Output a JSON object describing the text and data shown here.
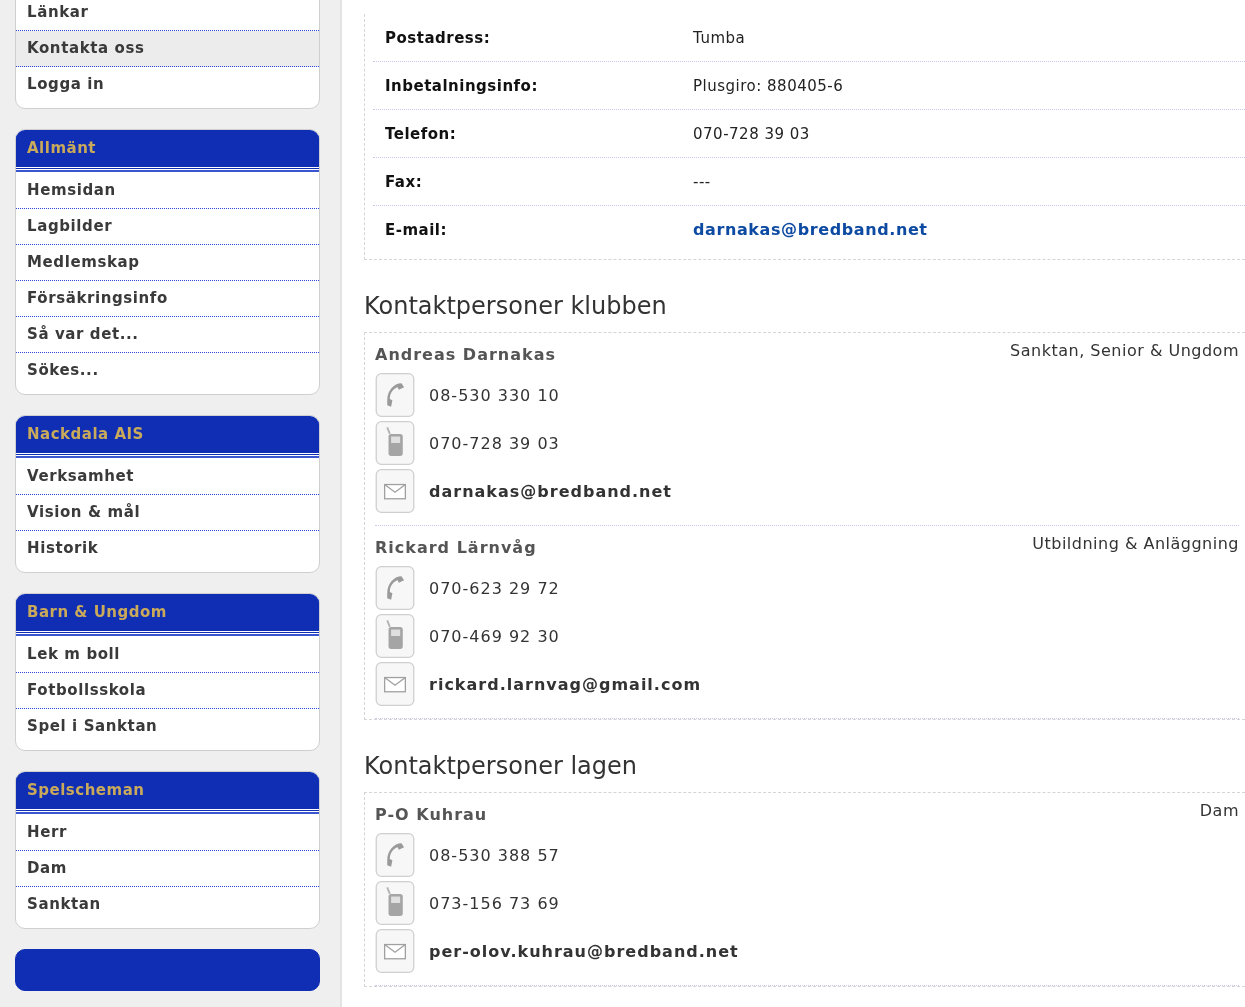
{
  "sidebar": {
    "groups": [
      {
        "items": [
          {
            "label": "Länkar",
            "selected": false
          },
          {
            "label": "Kontakta oss",
            "selected": true
          },
          {
            "label": "Logga in",
            "selected": false
          }
        ]
      },
      {
        "title": "Allmänt",
        "items": [
          {
            "label": "Hemsidan",
            "selected": false
          },
          {
            "label": "Lagbilder",
            "selected": false
          },
          {
            "label": "Medlemskap",
            "selected": false
          },
          {
            "label": "Försäkringsinfo",
            "selected": false
          },
          {
            "label": "Så var det...",
            "selected": false
          },
          {
            "label": "Sökes...",
            "selected": false
          }
        ]
      },
      {
        "title": "Nackdala AIS",
        "items": [
          {
            "label": "Verksamhet",
            "selected": false
          },
          {
            "label": "Vision & mål",
            "selected": false
          },
          {
            "label": "Historik",
            "selected": false
          }
        ]
      },
      {
        "title": "Barn & Ungdom",
        "items": [
          {
            "label": "Lek m boll",
            "selected": false
          },
          {
            "label": "Fotbollsskola",
            "selected": false
          },
          {
            "label": "Spel i Sanktan",
            "selected": false
          }
        ]
      },
      {
        "title": "Spelscheman",
        "items": [
          {
            "label": "Herr",
            "selected": false
          },
          {
            "label": "Dam",
            "selected": false
          },
          {
            "label": "Sanktan",
            "selected": false
          }
        ]
      }
    ]
  },
  "info": [
    {
      "label": "Postadress:",
      "value": "Tumba",
      "kind": "text"
    },
    {
      "label": "Inbetalningsinfo:",
      "value": "Plusgiro: 880405-6",
      "kind": "text"
    },
    {
      "label": "Telefon:",
      "value": "070-728 39 03",
      "kind": "text"
    },
    {
      "label": "Fax:",
      "value": "---",
      "kind": "text"
    },
    {
      "label": "E-mail:",
      "value": "darnakas@bredband.net",
      "kind": "link"
    }
  ],
  "sections": [
    {
      "title": "Kontaktpersoner klubben",
      "contacts": [
        {
          "name": "Andreas Darnakas",
          "role": "Sanktan, Senior & Ungdom",
          "lines": [
            {
              "kind": "phone",
              "value": "08-530 330 10"
            },
            {
              "kind": "mobile",
              "value": "070-728 39 03"
            },
            {
              "kind": "email",
              "value": "darnakas@bredband.net"
            }
          ]
        },
        {
          "name": "Rickard Lärnvåg",
          "role": "Utbildning & Anläggning",
          "lines": [
            {
              "kind": "phone",
              "value": "070-623 29 72"
            },
            {
              "kind": "mobile",
              "value": "070-469 92 30"
            },
            {
              "kind": "email",
              "value": "rickard.larnvag@gmail.com"
            }
          ]
        }
      ]
    },
    {
      "title": "Kontaktpersoner lagen",
      "contacts": [
        {
          "name": "P-O Kuhrau",
          "role": "Dam",
          "lines": [
            {
              "kind": "phone",
              "value": "08-530 388 57"
            },
            {
              "kind": "mobile",
              "value": "073-156 73 69"
            },
            {
              "kind": "email",
              "value": "per-olov.kuhrau@bredband.net"
            }
          ]
        }
      ]
    }
  ]
}
